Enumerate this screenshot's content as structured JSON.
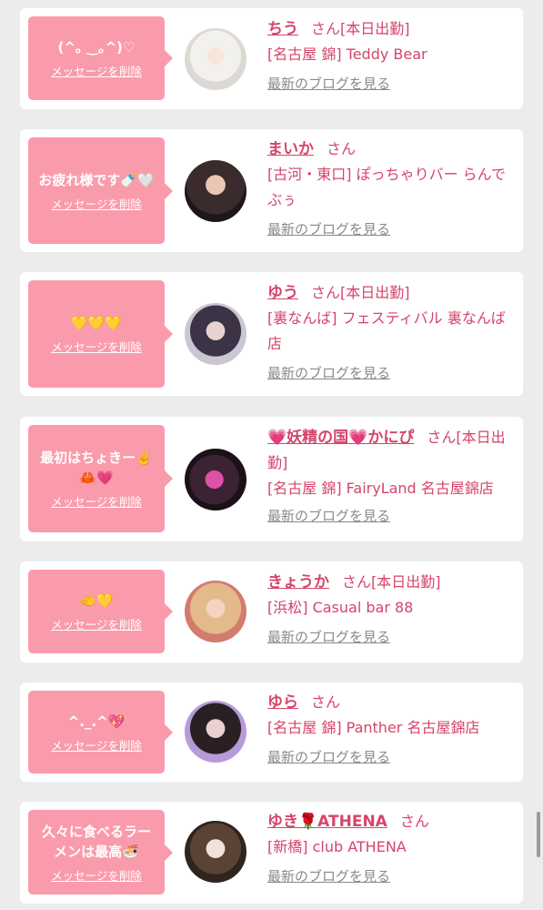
{
  "delete_label": "メッセージを削除",
  "san_label": "さん",
  "blog_label": "最新のブログを見る",
  "accent_color": "#d5456a",
  "bubble_color": "#fa9bab",
  "messages": [
    {
      "message": "(^｡ ‿｡^)♡",
      "name": "ちう",
      "status": "[本日出勤]",
      "shop": "[名古屋 錦] Teddy Bear"
    },
    {
      "message": "お疲れ様です🍼🤍",
      "name": "まいか",
      "status": "",
      "shop": "[古河・東口] ぽっちゃりバー らんでぶぅ"
    },
    {
      "message": "💛💛💛",
      "name": "ゆう",
      "status": "[本日出勤]",
      "shop": "[裏なんば] フェスティバル 裏なんば店"
    },
    {
      "message": "最初はちょきー✌️🦀💗",
      "name": "💗妖精の国💗かにぴ",
      "status": "[本日出勤]",
      "shop": "[名古屋 錦] FairyLand 名古屋錦店"
    },
    {
      "message": "🫲💛",
      "name": "きょうか",
      "status": "[本日出勤]",
      "shop": "[浜松] Casual bar 88"
    },
    {
      "message": "^._.^💖",
      "name": "ゆら",
      "status": "",
      "shop": "[名古屋 錦] Panther 名古屋錦店"
    },
    {
      "message": "久々に食べるラーメンは最高🍜",
      "name": "ゆき🌹ATHENA",
      "status": "",
      "shop": "[新橋] club ATHENA"
    }
  ]
}
